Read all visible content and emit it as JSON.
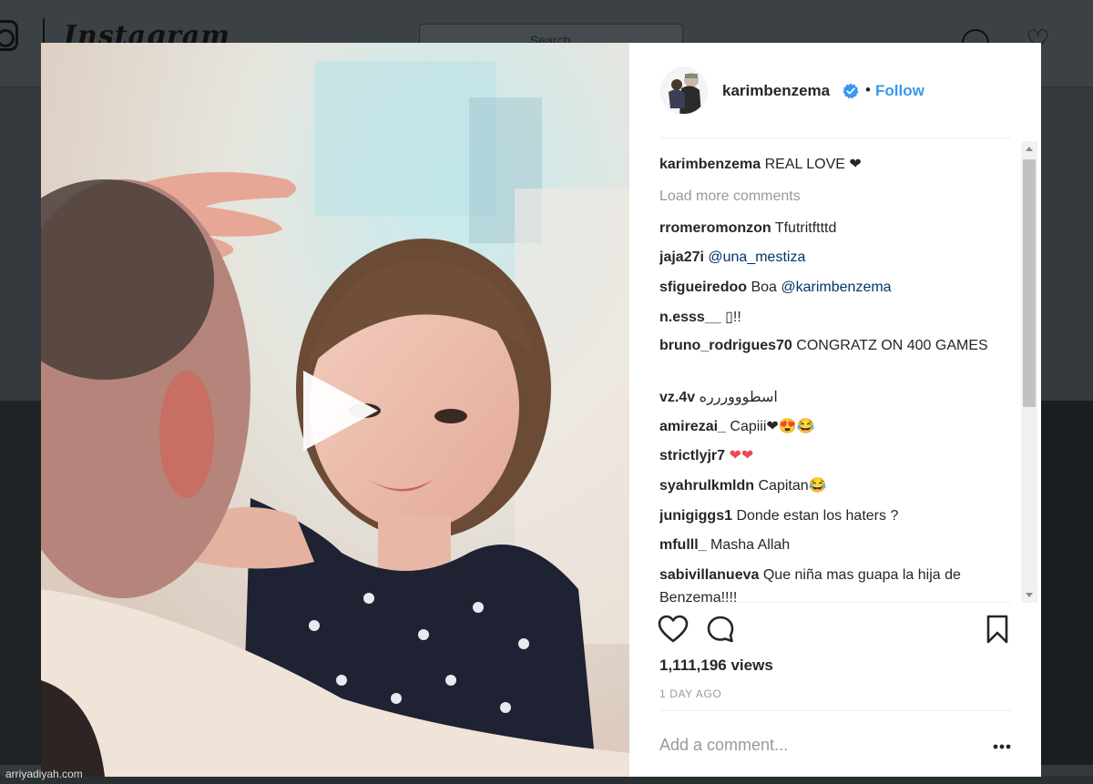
{
  "background": {
    "wordmark": "Instagram",
    "search_placeholder": "Search"
  },
  "credit": "arriyadiyah.com",
  "post": {
    "username": "karimbenzema",
    "separator": "•",
    "follow_label": "Follow",
    "caption_user": "karimbenzema",
    "caption_text": "REAL LOVE ❤",
    "load_more": "Load more comments",
    "comments": [
      {
        "user": "rromeromonzon",
        "text": "Tfutritftttd"
      },
      {
        "user": "jaja27i",
        "mention": "@una_mestiza"
      },
      {
        "user": "sfigueiredoo",
        "text": "Boa",
        "mention": "@karimbenzema"
      },
      {
        "user": "n.esss__",
        "text": "▯!!"
      },
      {
        "user": "bruno_rodrigues70",
        "text": "CONGRATZ ON 400 GAMES"
      },
      {
        "user": "vz.4v",
        "text": "اسطوووررره"
      },
      {
        "user": "amirezai_",
        "text": "Capiii❤😍😂"
      },
      {
        "user": "strictlyjr7",
        "text": "❤❤"
      },
      {
        "user": "syahrulkmldn",
        "text": "Capitan😂"
      },
      {
        "user": "junigiggs1",
        "text": "Donde estan los haters ?"
      },
      {
        "user": "mfulll_",
        "text": "Masha Allah"
      },
      {
        "user": "sabivillanueva",
        "text": "Que niña mas guapa la hija de Benzema!!!!"
      }
    ],
    "views": "1,111,196 views",
    "time_ago": "1 DAY AGO",
    "add_comment_placeholder": "Add a comment..."
  },
  "colors": {
    "link": "#3897f0",
    "mention": "#003569",
    "heart": "#ed4956",
    "muted": "#999999"
  },
  "icons": [
    "play-icon",
    "verified-badge-icon",
    "heart-icon",
    "comment-bubble-icon",
    "bookmark-icon",
    "more-options-icon"
  ]
}
